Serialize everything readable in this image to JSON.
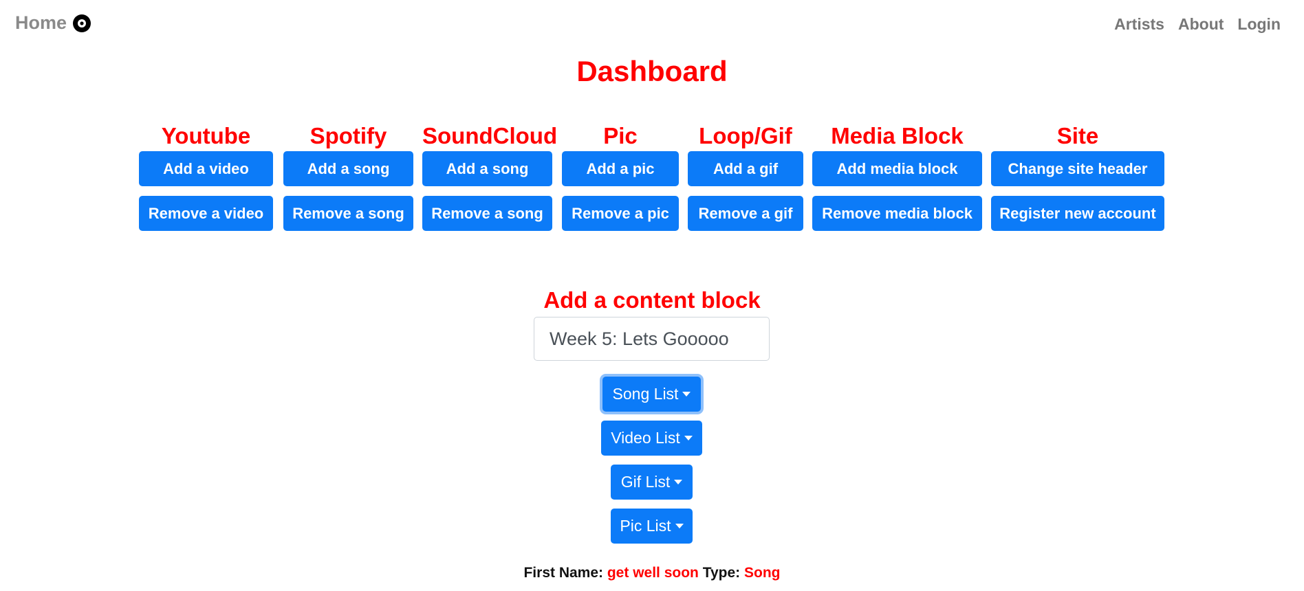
{
  "nav": {
    "brand": "Home",
    "links": [
      "Artists",
      "About",
      "Login"
    ]
  },
  "page_title": "Dashboard",
  "columns": [
    {
      "title": "Youtube",
      "add": "Add a video",
      "remove": "Remove a video"
    },
    {
      "title": "Spotify",
      "add": "Add a song",
      "remove": "Remove a song"
    },
    {
      "title": "SoundCloud",
      "add": "Add a song",
      "remove": "Remove a song"
    },
    {
      "title": "Pic",
      "add": "Add a pic",
      "remove": "Remove a pic"
    },
    {
      "title": "Loop/Gif",
      "add": "Add a gif",
      "remove": "Remove a gif"
    },
    {
      "title": "Media Block",
      "add": "Add media block",
      "remove": "Remove media block"
    },
    {
      "title": "Site",
      "add": "Change site header",
      "remove": "Register new account"
    }
  ],
  "content_block": {
    "title": "Add a content block",
    "name_value": "Week 5: Lets Gooooo",
    "dropdowns": [
      "Song List",
      "Video List",
      "Gif List",
      "Pic List"
    ]
  },
  "info": {
    "first_name_label": "First Name:",
    "first_name_value": "get well soon",
    "type_label": "Type:",
    "type_value": "Song"
  },
  "colors": {
    "accent": "#0c7bf8",
    "heading": "#ff0000"
  },
  "icons": {
    "brand": "vinyl-disc-icon",
    "dropdown": "caret-down-icon"
  }
}
